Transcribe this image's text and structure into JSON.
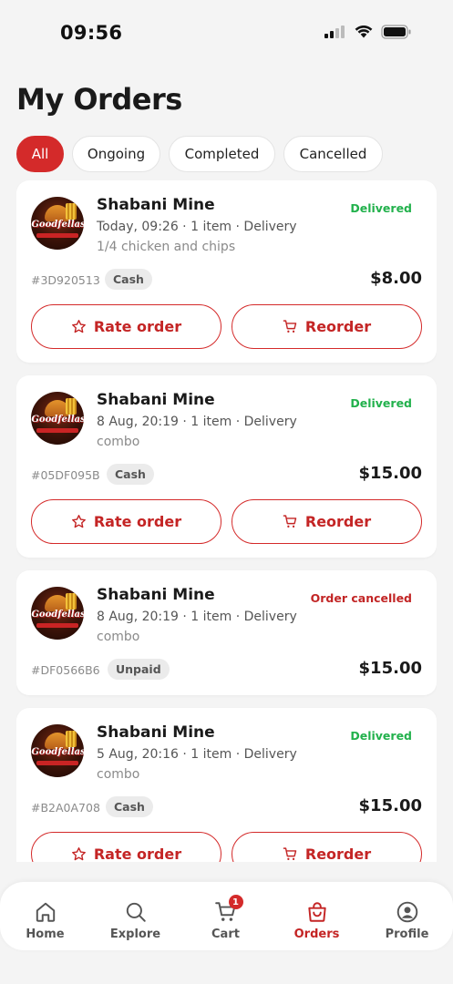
{
  "status_bar": {
    "time": "09:56"
  },
  "page": {
    "title": "My Orders"
  },
  "filters": [
    {
      "label": "All",
      "active": true
    },
    {
      "label": "Ongoing",
      "active": false
    },
    {
      "label": "Completed",
      "active": false
    },
    {
      "label": "Cancelled",
      "active": false
    }
  ],
  "brand_logo_text": "Goodfellas",
  "buttons": {
    "rate": "Rate order",
    "reorder": "Reorder"
  },
  "orders": [
    {
      "restaurant": "Shabani Mine",
      "meta": "Today, 09:26 · 1 item · Delivery",
      "description": "1/4 chicken and chips",
      "status": "Delivered",
      "status_type": "delivered",
      "id": "#3D920513",
      "payment": "Cash",
      "price": "$8.00"
    },
    {
      "restaurant": "Shabani Mine",
      "meta": "8 Aug, 20:19 · 1 item · Delivery",
      "description": "combo",
      "status": "Delivered",
      "status_type": "delivered",
      "id": "#05DF095B",
      "payment": "Cash",
      "price": "$15.00"
    },
    {
      "restaurant": "Shabani Mine",
      "meta": "8 Aug, 20:19 · 1 item · Delivery",
      "description": "combo",
      "status": "Order cancelled",
      "status_type": "cancelled",
      "id": "#DF0566B6",
      "payment": "Unpaid",
      "price": "$15.00"
    },
    {
      "restaurant": "Shabani Mine",
      "meta": "5 Aug, 20:16 · 1 item · Delivery",
      "description": "combo",
      "status": "Delivered",
      "status_type": "delivered",
      "id": "#B2A0A708",
      "payment": "Cash",
      "price": "$15.00"
    }
  ],
  "nav": {
    "home": "Home",
    "explore": "Explore",
    "cart": "Cart",
    "cart_count": "1",
    "orders": "Orders",
    "profile": "Profile"
  },
  "colors": {
    "accent": "#d42a2a",
    "delivered": "#22b14c",
    "cancelled": "#c22525"
  },
  "icons": [
    "signal-icon",
    "wifi-icon",
    "battery-icon",
    "star-icon",
    "cart-icon",
    "home-icon",
    "search-icon",
    "bag-icon",
    "user-icon"
  ]
}
